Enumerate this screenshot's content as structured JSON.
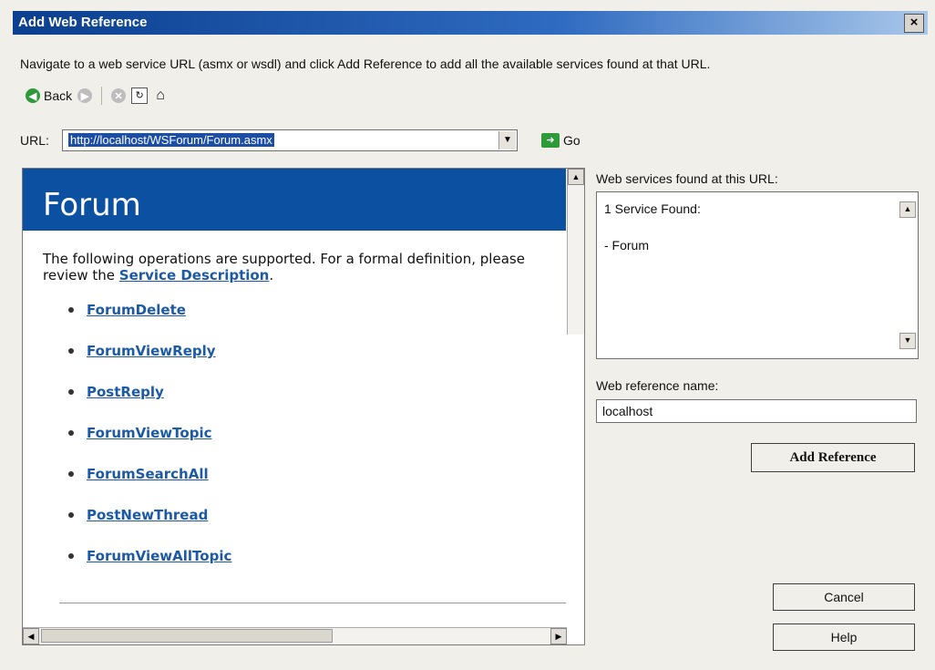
{
  "window": {
    "title": "Add Web Reference",
    "close_label": "×"
  },
  "instruction": "Navigate to a web service URL (asmx or wsdl) and click Add Reference to add all the available services found at that URL.",
  "toolbar": {
    "back_label": "Back"
  },
  "url": {
    "label": "URL:",
    "value": "http://localhost/WSForum/Forum.asmx",
    "go_label": "Go"
  },
  "browser": {
    "title": "Forum",
    "description_prefix": "The following operations are supported. For a formal definition, please review the ",
    "service_description_link": "Service Description",
    "description_suffix": ".",
    "operations": [
      "ForumDelete",
      "ForumViewReply",
      "PostReply",
      "ForumViewTopic",
      "ForumSearchAll",
      "PostNewThread",
      "ForumViewAllTopic"
    ]
  },
  "services": {
    "label": "Web services found at this URL:",
    "count_text": "1 Service Found:",
    "items": [
      "- Forum"
    ]
  },
  "reference": {
    "label": "Web reference name:",
    "value": "localhost"
  },
  "buttons": {
    "add_reference": "Add Reference",
    "cancel": "Cancel",
    "help": "Help"
  },
  "colors": {
    "title_bar": "#0b3f8f",
    "browser_header": "#0c51a1",
    "link": "#1d5aa5"
  }
}
